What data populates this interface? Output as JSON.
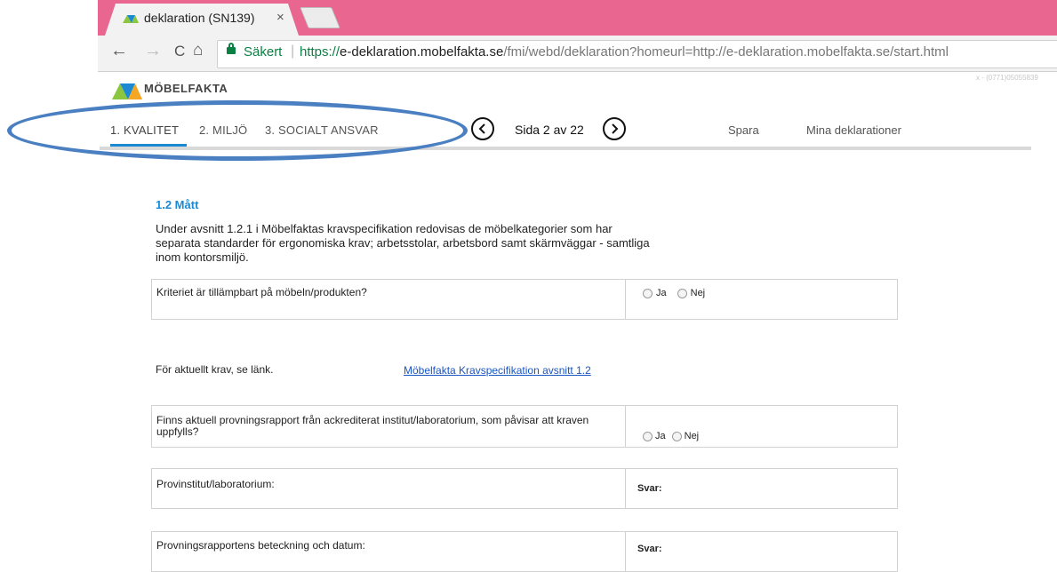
{
  "browser": {
    "tab_title": "deklaration (SN139)",
    "tab_close": "×",
    "secure_label": "Säkert",
    "url_scheme": "https://",
    "url_host": "e-deklaration.mobelfakta.se",
    "url_path": "/fmi/webd/deklaration?homeurl=http://e-deklaration.mobelfakta.se/start.html",
    "back": "←",
    "forward": "→",
    "reload": "C",
    "home": "⌂"
  },
  "header": {
    "logo_text": "MÖBELFAKTA",
    "corner_text": "x - (0771)05055839"
  },
  "nav": {
    "steps": [
      "1. KVALITET",
      "2. MILJÖ",
      "3. SOCIALT ANSVAR"
    ],
    "page_label": "Sida 2 av 22",
    "save": "Spara",
    "my_declarations": "Mina deklarationer"
  },
  "section": {
    "title": "1.2  Mått",
    "intro": "Under avsnitt 1.2.1 i Möbelfaktas kravspecifikation redovisas de möbelkategorier som har separata standarder för ergonomiska krav; arbetsstolar, arbetsbord samt skärmväggar - samtliga inom kontorsmiljö."
  },
  "questions": {
    "q1": "Kriteriet är tillämpbart på möbeln/produkten?",
    "link_prompt": "För aktuellt krav, se länk.",
    "link_text": "Möbelfakta Kravspecifikation avsnitt 1.2",
    "q2": "Finns aktuell provningsrapport från ackrediterat institut/laboratorium, som påvisar att kraven uppfylls?",
    "q3": "Provinstitut/laboratorium:",
    "q4": "Provningsrapportens beteckning och datum:"
  },
  "answers": {
    "yes": "Ja",
    "no": "Nej",
    "svar": "Svar:"
  },
  "colors": {
    "tabbar": "#e8668f",
    "accent": "#1b8ad3",
    "annotation": "#4a7fc1",
    "secure": "#0b8043",
    "link": "#1a56c4"
  }
}
